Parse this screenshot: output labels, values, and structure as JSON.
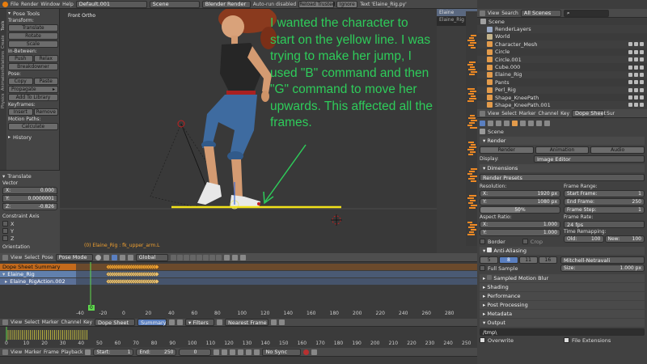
{
  "menubar": {
    "menus": [
      "File",
      "Render",
      "Window",
      "Help"
    ],
    "layout": "Default.001",
    "scene": "Scene",
    "engine": "Blender Render",
    "autorun": "Auto-run disabled",
    "reload": "Reload Trusted",
    "ignore": "Ignore",
    "text_info": "Text 'Elaine_Rig.py'"
  },
  "topright": {
    "text_tab": "Elaine",
    "text_sub": "Elaine_Rig"
  },
  "tools": {
    "title": "Pose Tools",
    "vtabs": [
      "Tools",
      "Create",
      "Relations",
      "Animation",
      "Physics",
      "Grease Pencil"
    ],
    "transform_label": "Transform:",
    "translate": "Translate",
    "rotate": "Rotate",
    "scale": "Scale",
    "inbetween_label": "In-Between:",
    "push": "Push",
    "relax": "Relax",
    "breakdowner": "Breakdowner",
    "pose_label": "Pose:",
    "copy": "Copy",
    "paste": "Paste",
    "propagate": "Propagate",
    "add_library": "Add To Library",
    "keyframes_label": "Keyframes:",
    "insert": "Insert",
    "remove": "Remove",
    "motion_label": "Motion Paths:",
    "calculate": "Calculate",
    "history": "History"
  },
  "operator": {
    "title": "Translate",
    "vector": "Vector",
    "x_label": "X:",
    "x_val": "0.000",
    "y_label": "Y:",
    "y_val": "0.0000001",
    "z_label": "Z:",
    "z_val": "-0.826",
    "constraint": "Constraint Axis",
    "cx": "X",
    "cy": "Y",
    "cz": "Z",
    "orientation": "Orientation"
  },
  "viewport": {
    "view_name": "Front Ortho",
    "status": "(0) Elaine_Rig : fk_upper_arm.L",
    "annotation": "I wanted the character to start on the yellow line. I was trying to make her jump, I used \"B\" command and then \"G\" command to move her upwards. This affected all the frames.",
    "header": {
      "view": "View",
      "select": "Select",
      "pose": "Pose",
      "mode": "Pose Mode",
      "orient": "Global"
    }
  },
  "outliner": {
    "view": "View",
    "search": "Search",
    "scope": "All Scenes",
    "items": [
      {
        "name": "Scene",
        "color": "#a0a0a0"
      },
      {
        "name": "RenderLayers",
        "color": "#9aa9c4"
      },
      {
        "name": "World",
        "color": "#c4b38a"
      },
      {
        "name": "Character_Mesh",
        "color": "#e39b4b"
      },
      {
        "name": "Circle",
        "color": "#e39b4b"
      },
      {
        "name": "Circle.001",
        "color": "#e39b4b"
      },
      {
        "name": "Cube.000",
        "color": "#e39b4b"
      },
      {
        "name": "Elaine_Rig",
        "color": "#e39b4b"
      },
      {
        "name": "Pants",
        "color": "#e39b4b"
      },
      {
        "name": "Perl_Rig",
        "color": "#e39b4b"
      },
      {
        "name": "Shape_KneePath",
        "color": "#e39b4b"
      },
      {
        "name": "Shape_KneePath.001",
        "color": "#e39b4b"
      }
    ]
  },
  "dopeheader": {
    "view": "View",
    "select": "Select",
    "marker": "Marker",
    "channel": "Channel",
    "key": "Key",
    "mode": "Dope Sheet",
    "sur": "Sur"
  },
  "properties": {
    "scene": "Scene",
    "render": "Render",
    "render_btn": "Render",
    "animation_btn": "Animation",
    "audio_btn": "Audio",
    "display_label": "Display:",
    "display_val": "Image Editor",
    "dimensions": "Dimensions",
    "presets": "Render Presets",
    "resolution": "Resolution:",
    "res_x_label": "X:",
    "res_x": "1920 px",
    "res_y_label": "Y:",
    "res_y": "1080 px",
    "res_pct": "50%",
    "frame_range": "Frame Range:",
    "start_label": "Start Frame:",
    "start": "1",
    "end_label": "End Frame:",
    "end": "250",
    "step_label": "Frame Step:",
    "step": "1",
    "aspect": "Aspect Ratio:",
    "asp_x_label": "X:",
    "asp_x": "1.000",
    "asp_y_label": "Y:",
    "asp_y": "1.000",
    "frame_rate": "Frame Rate:",
    "fps": "24 fps",
    "time_remap": "Time Remapping:",
    "old": "Old:",
    "old_val": "100",
    "new": "New:",
    "new_val": "100",
    "border": "Border",
    "crop": "Crop",
    "aa": "Anti-Aliasing",
    "aa_samples": [
      "5",
      "8",
      "11",
      "16"
    ],
    "aa_filter": "Mitchell-Netravali",
    "full_sample": "Full Sample",
    "size_label": "Size:",
    "size_val": "1.000 px",
    "sampled_blur": "Sampled Motion Blur",
    "shading": "Shading",
    "performance": "Performance",
    "post": "Post Processing",
    "metadata": "Metadata",
    "output": "Output",
    "output_path": "/tmp\\",
    "overwrite": "Overwrite",
    "file_ext": "File Extensions"
  },
  "dopesheet": {
    "channels": [
      "Dope Sheet Summary",
      "Elaine_Rig",
      "Elaine_RigAction.002"
    ],
    "current_frame": "0",
    "ticks": [
      "-40",
      "-20",
      "0",
      "20",
      "40",
      "60",
      "80",
      "100",
      "120",
      "140",
      "160",
      "180",
      "200",
      "220",
      "240",
      "260",
      "280"
    ],
    "header": {
      "view": "View",
      "select": "Select",
      "marker": "Marker",
      "channel": "Channel",
      "key": "Key",
      "mode": "Dope Sheet",
      "summary": "Summary",
      "filters": "Filters",
      "snap": "Nearest Frame"
    }
  },
  "timeline": {
    "ticks": [
      "0",
      "10",
      "20",
      "30",
      "40",
      "50",
      "60",
      "70",
      "80",
      "90",
      "100",
      "110",
      "120",
      "130",
      "140",
      "150",
      "160",
      "170",
      "180",
      "190",
      "200",
      "210",
      "220",
      "230",
      "240",
      "250"
    ],
    "header": {
      "view": "View",
      "marker": "Marker",
      "frame": "Frame",
      "playback": "Playback",
      "start_label": "Start:",
      "start": "1",
      "end_label": "End:",
      "end": "250",
      "current": "0",
      "sync": "No Sync"
    }
  },
  "colors": {
    "annotation": "#2ecc5a",
    "yellow_line": "#f2e21a",
    "keyframe": "#f0a030",
    "selected": "#f08a24"
  }
}
